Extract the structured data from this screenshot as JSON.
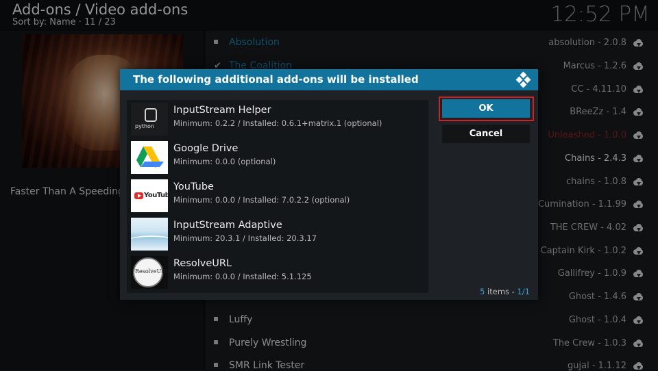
{
  "header": {
    "title": "Add-ons / Video add-ons",
    "sort": "Sort by: Name  ·  11 / 23",
    "clock": "12:52 PM"
  },
  "description": "Faster Than A Speeding",
  "background_list": [
    {
      "name": "Absolution",
      "version": "absolution - 2.0.8"
    },
    {
      "name": "The Coalition",
      "version": "Marcus - 1.2.6"
    },
    {
      "name": "",
      "version": "CC - 4.11.10"
    },
    {
      "name": "",
      "version": "BReeZz - 1.4"
    },
    {
      "name": "",
      "version": "Unleashed - 1.0.0"
    },
    {
      "name": "",
      "version": "Chains - 2.4.3"
    },
    {
      "name": "",
      "version": "chains - 1.0.8"
    },
    {
      "name": "",
      "version": "Cumination - 1.1.99"
    },
    {
      "name": "",
      "version": "THE CREW - 4.02"
    },
    {
      "name": "",
      "version": "Captain Kirk - 1.0.2"
    },
    {
      "name": "",
      "version": "Gallifrey - 1.0.9"
    },
    {
      "name": "",
      "version": "Ghost - 1.4.6"
    },
    {
      "name": "Luffy",
      "version": "Ghost - 1.0.4"
    },
    {
      "name": "Purely Wrestling",
      "version": "The Crew - 1.0.3"
    },
    {
      "name": "SMR Link Tester",
      "version": "gujal - 1.1.12"
    }
  ],
  "dialog": {
    "title": "The following additional add-ons will be installed",
    "ok_label": "OK",
    "cancel_label": "Cancel",
    "items_count": "5",
    "items_label": " items - ",
    "page": "1/1",
    "items": [
      {
        "name": "InputStream Helper",
        "detail": "Minimum: 0.2.2 / Installed: 0.6.1+matrix.1 (optional)",
        "thumb_text": "python"
      },
      {
        "name": "Google Drive",
        "detail": "Minimum: 0.0.0 (optional)",
        "thumb_text": ""
      },
      {
        "name": "YouTube",
        "detail": "Minimum: 0.0.0 / Installed: 7.0.2.2 (optional)",
        "thumb_text": "YouTube"
      },
      {
        "name": "InputStream Adaptive",
        "detail": "Minimum: 20.3.1 / Installed: 20.3.17",
        "thumb_text": ""
      },
      {
        "name": "ResolveURL",
        "detail": "Minimum: 0.0.0 / Installed: 5.1.125",
        "thumb_text": "ResolveURL"
      }
    ]
  },
  "colors": {
    "accent": "#12739c",
    "focus_ring": "#d21f1f",
    "highlight_text": "#3aa0d0"
  }
}
